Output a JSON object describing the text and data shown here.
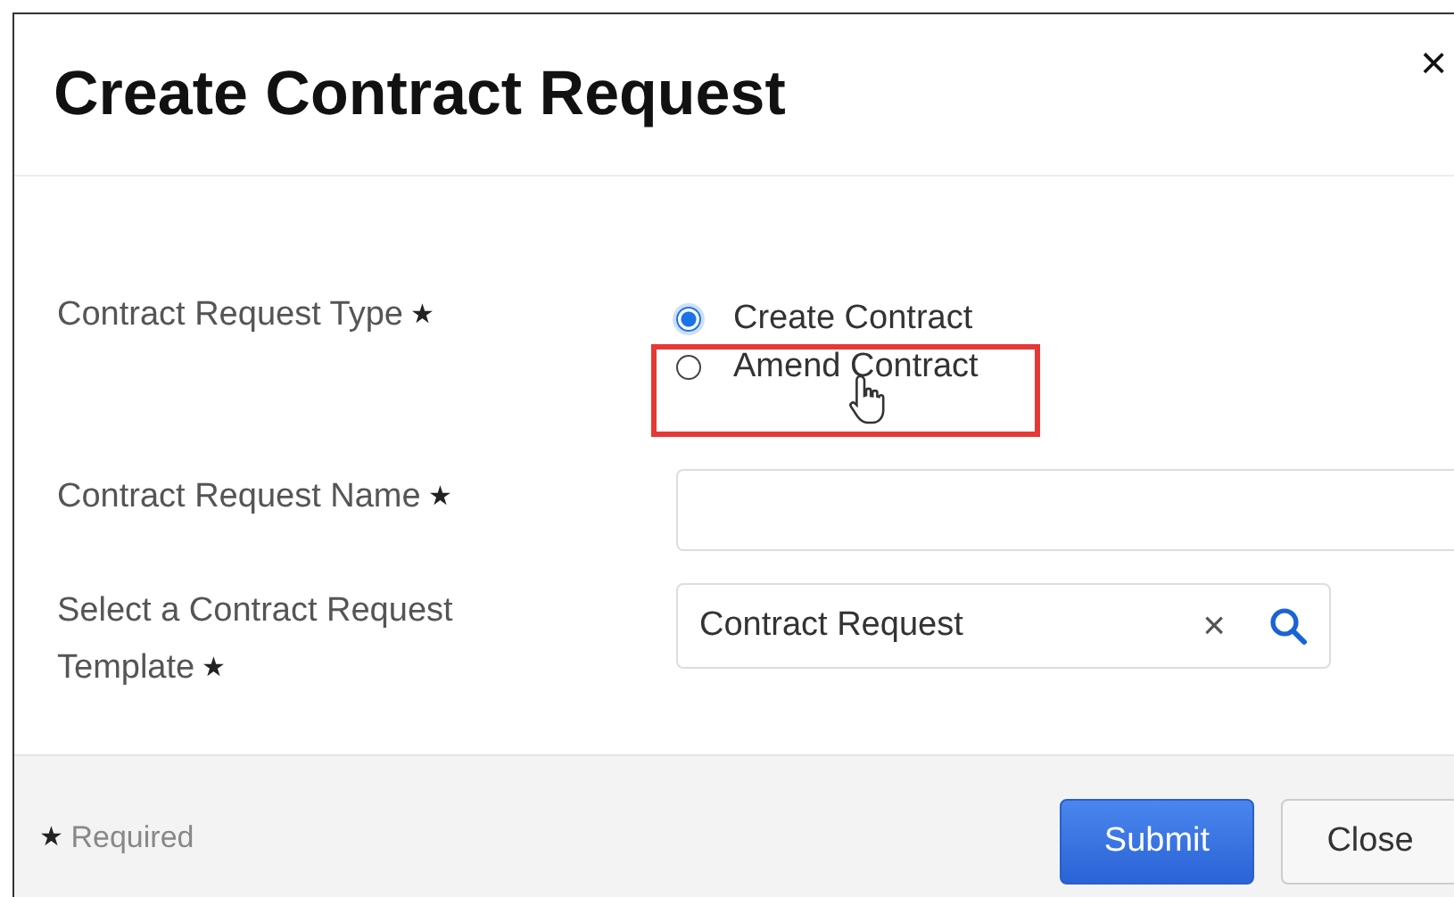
{
  "dialog": {
    "title": "Create Contract Request",
    "close_glyph": "×"
  },
  "required_mark": "★",
  "fields": [
    {
      "kind": "radio",
      "label": "Contract Request Type",
      "required": true,
      "options": [
        {
          "label": "Create Contract",
          "selected": true
        },
        {
          "label": "Amend Contract",
          "selected": false,
          "highlighted": true
        }
      ]
    },
    {
      "kind": "text",
      "label": "Contract Request Name",
      "required": true
    },
    {
      "kind": "lookup",
      "label": "Select a Contract Request Template",
      "required": true,
      "value": "Contract Request",
      "clear_glyph": "×"
    }
  ],
  "footer": {
    "mark": "★",
    "note": "Required",
    "buttons": [
      {
        "label": "Submit",
        "kind": "primary"
      },
      {
        "label": "Close",
        "kind": "secondary"
      }
    ]
  }
}
